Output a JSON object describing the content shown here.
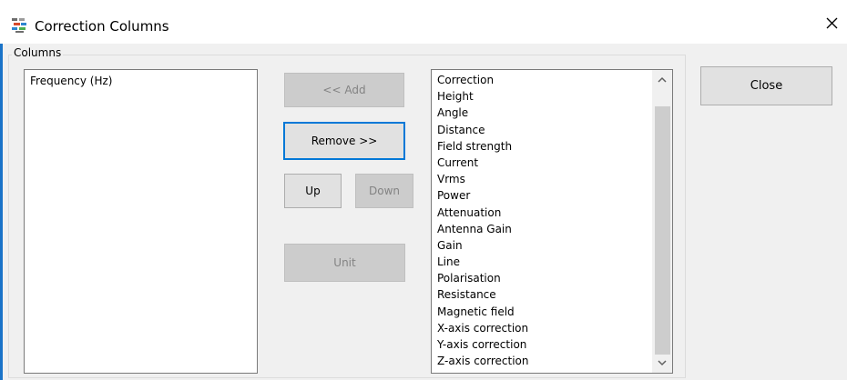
{
  "window": {
    "title": "Correction Columns",
    "accent_color": "#0078d7",
    "icon": "app-columns-icon",
    "close_icon": "close-icon"
  },
  "group": {
    "label": "Columns"
  },
  "selected_list": {
    "items": [
      "Frequency (Hz)"
    ]
  },
  "available_list": {
    "items": [
      "Correction",
      "Height",
      "Angle",
      "Distance",
      "Field strength",
      "Current",
      "Vrms",
      "Power",
      "Attenuation",
      "Antenna Gain",
      "Gain",
      "Line",
      "Polarisation",
      "Resistance",
      "Magnetic field",
      "X-axis correction",
      "Y-axis correction",
      "Z-axis correction"
    ]
  },
  "buttons": {
    "add": "<< Add",
    "remove": "Remove >>",
    "up": "Up",
    "down": "Down",
    "unit": "Unit",
    "close": "Close"
  }
}
